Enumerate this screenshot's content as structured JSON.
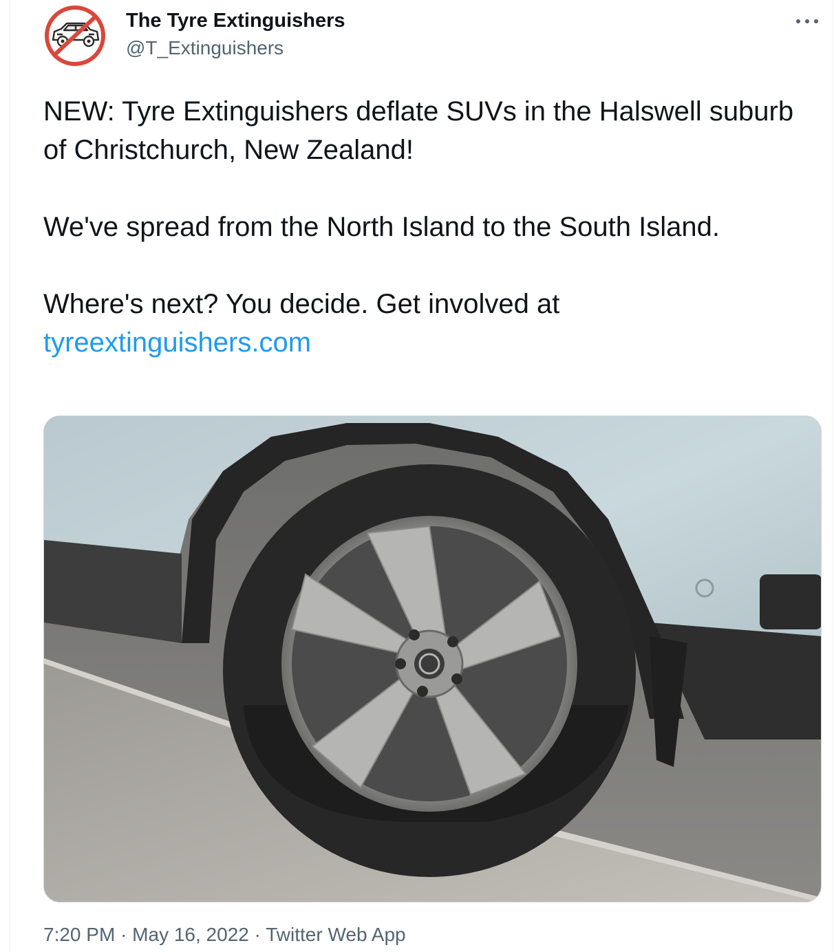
{
  "author": {
    "display_name": "The Tyre Extinguishers",
    "handle": "@T_Extinguishers",
    "avatar_icon": "no-suv-icon"
  },
  "tweet": {
    "line1": "NEW: Tyre Extinguishers deflate SUVs in the Halswell suburb of Christchurch, New Zealand!",
    "line2": "We've spread from the North Island to the South Island.",
    "line3_prefix": "Where's next? You decide. Get involved at",
    "link_text": "tyreextinguishers.com"
  },
  "media": {
    "image_icon": "deflated-suv-tyre-photo"
  },
  "meta": {
    "time": "7:20 PM",
    "separator": "·",
    "date": "May 16, 2022",
    "source": "Twitter Web App"
  },
  "colors": {
    "text": "#0f1419",
    "secondary": "#536471",
    "link": "#1d9bf0",
    "prohibition_red": "#d9483b"
  },
  "more_icon": "more-options-icon"
}
